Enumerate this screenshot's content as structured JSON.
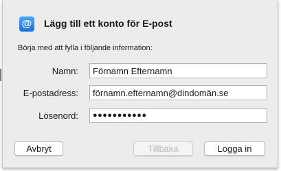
{
  "dialog": {
    "icon": "mail-at-icon",
    "icon_glyph": "@",
    "title": "Lägg till ett konto för E-post",
    "subtitle": "Börja med att fylla i följande information:"
  },
  "form": {
    "name": {
      "label": "Namn:",
      "value": "Förnamn Efternamn"
    },
    "email": {
      "label": "E-postadress:",
      "value": "förnamn.efternamn@dindomän.se"
    },
    "password": {
      "label": "Lösenord:",
      "value": "●●●●●●●●●●●"
    }
  },
  "buttons": {
    "cancel": "Avbryt",
    "back": "Tillbaka",
    "login": "Logga in"
  },
  "colors": {
    "sheet_background": "#ececec",
    "icon_accent": "#1a6fdf",
    "disabled_text": "#b8b8b8"
  }
}
